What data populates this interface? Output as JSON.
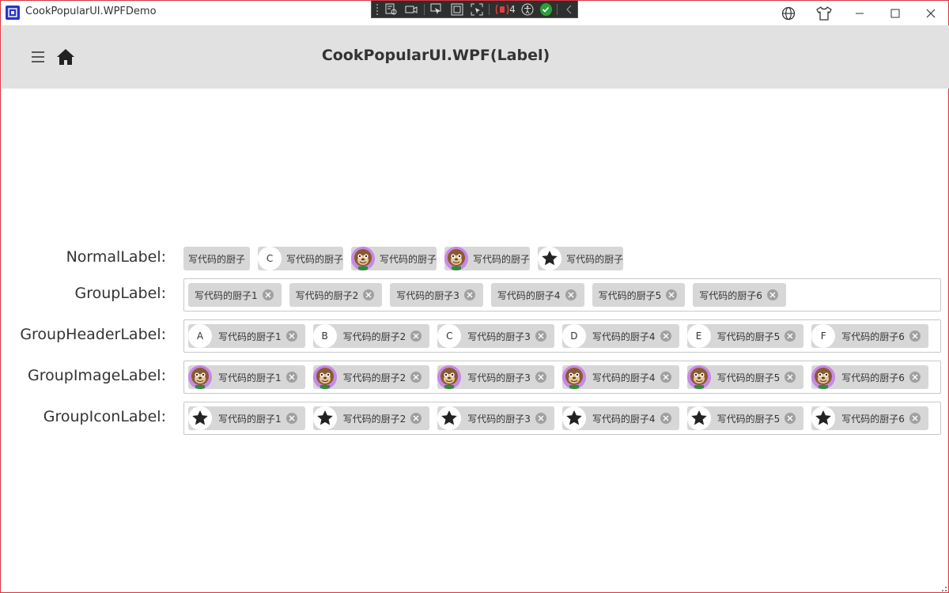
{
  "window": {
    "title": "CookPopularUI.WPFDemo"
  },
  "debug_toolbar": {
    "count": "4",
    "icons": [
      "live-visual-tree-icon",
      "camera-icon",
      "select-element-icon",
      "display-layout-adorners-icon",
      "track-focus-icon",
      "binding-failures-icon",
      "accessibility-icon",
      "check-icon",
      "collapse-icon"
    ]
  },
  "caption": {
    "icons": [
      "globe-icon",
      "shirt-icon",
      "minimize-icon",
      "maximize-icon",
      "close-icon"
    ]
  },
  "header": {
    "title": "CookPopularUI.WPF(Label)"
  },
  "rows": {
    "normal": {
      "label": "NormalLabel:",
      "chips": [
        {
          "kind": "plain",
          "text": "写代码的厨子"
        },
        {
          "kind": "letter",
          "lead": "C",
          "text": "写代码的厨子"
        },
        {
          "kind": "image",
          "text": "写代码的厨子"
        },
        {
          "kind": "image",
          "text": "写代码的厨子"
        },
        {
          "kind": "icon",
          "text": "写代码的厨子"
        }
      ]
    },
    "group": {
      "label": "GroupLabel:",
      "chips": [
        "写代码的厨子1",
        "写代码的厨子2",
        "写代码的厨子3",
        "写代码的厨子4",
        "写代码的厨子5",
        "写代码的厨子6"
      ]
    },
    "group_header": {
      "label": "GroupHeaderLabel:",
      "leads": [
        "A",
        "B",
        "C",
        "D",
        "E",
        "F"
      ],
      "chips": [
        "写代码的厨子1",
        "写代码的厨子2",
        "写代码的厨子3",
        "写代码的厨子4",
        "写代码的厨子5",
        "写代码的厨子6"
      ]
    },
    "group_image": {
      "label": "GroupImageLabel:",
      "chips": [
        "写代码的厨子1",
        "写代码的厨子2",
        "写代码的厨子3",
        "写代码的厨子4",
        "写代码的厨子5",
        "写代码的厨子6"
      ]
    },
    "group_icon": {
      "label": "GroupIconLabel:",
      "chips": [
        "写代码的厨子1",
        "写代码的厨子2",
        "写代码的厨子3",
        "写代码的厨子4",
        "写代码的厨子5",
        "写代码的厨子6"
      ]
    }
  },
  "colors": {
    "window_border": "#d9343b",
    "header_bg": "#e1e1e1",
    "chip_bg": "#d7d7d7",
    "avatar_ring": "#c789e6",
    "app_icon": "#2b33c9"
  }
}
